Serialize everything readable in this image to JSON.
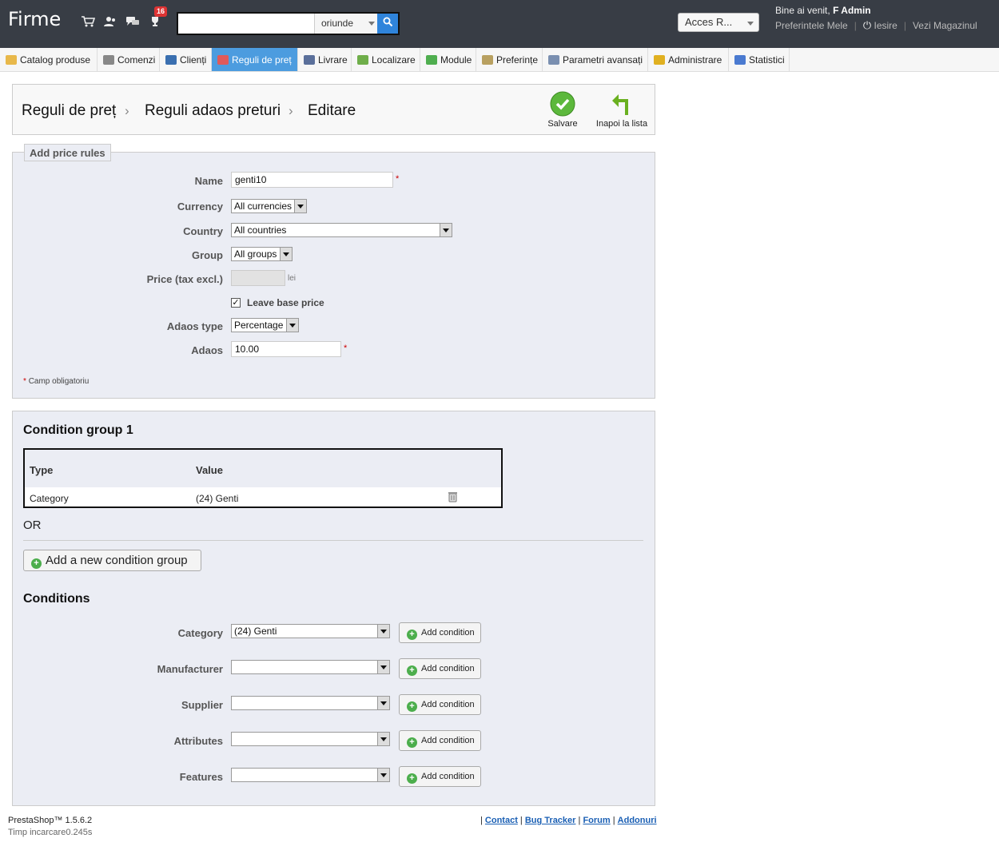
{
  "header": {
    "brand": "Firme",
    "badge_count": "16",
    "search_value": "",
    "search_scope": "oriunde",
    "access_select": "Acces R...",
    "welcome_prefix": "Bine ai venit,",
    "welcome_user": "F Admin",
    "link_prefs": "Preferintele Mele",
    "link_logout": "Iesire",
    "link_shop": "Vezi Magazinul"
  },
  "menu": [
    {
      "label": "Catalog produse",
      "icon": "folder-icon",
      "color": "#e8b84a"
    },
    {
      "label": "Comenzi",
      "icon": "cart-icon",
      "color": "#888888"
    },
    {
      "label": "Clienți",
      "icon": "user-icon",
      "color": "#3a6fb0"
    },
    {
      "label": "Reguli de preț",
      "icon": "price-rule-icon",
      "color": "#e05a5a"
    },
    {
      "label": "Livrare",
      "icon": "truck-icon",
      "color": "#5a6f9a"
    },
    {
      "label": "Localizare",
      "icon": "globe-icon",
      "color": "#6fae4a"
    },
    {
      "label": "Module",
      "icon": "puzzle-icon",
      "color": "#4fae4f"
    },
    {
      "label": "Preferințe",
      "icon": "preferences-icon",
      "color": "#b8a060"
    },
    {
      "label": "Parametri avansați",
      "icon": "wrench-icon",
      "color": "#7a8fb0"
    },
    {
      "label": "Administrare",
      "icon": "key-icon",
      "color": "#e0b020"
    },
    {
      "label": "Statistici",
      "icon": "stats-icon",
      "color": "#4a7ad0"
    }
  ],
  "breadcrumb": {
    "level1": "Reguli de preț",
    "level2": "Reguli adaos preturi",
    "level3": "Editare"
  },
  "toolbar": {
    "save_label": "Salvare",
    "back_label": "Inapoi la lista"
  },
  "form": {
    "legend": "Add price rules",
    "name_label": "Name",
    "name_value": "genti10",
    "currency_label": "Currency",
    "currency_value": "All currencies",
    "country_label": "Country",
    "country_value": "All countries",
    "group_label": "Group",
    "group_value": "All groups",
    "price_label": "Price (tax excl.)",
    "price_value": "",
    "price_unit": "lei",
    "leave_base_label": "Leave base price",
    "leave_base_checked": true,
    "adaos_type_label": "Adaos type",
    "adaos_type_value": "Percentage",
    "adaos_label": "Adaos",
    "adaos_value": "10.00",
    "required_note": "Camp obligatoriu",
    "required_mark": "*"
  },
  "conditions": {
    "group_title": "Condition group 1",
    "table_headers": [
      "Type",
      "Value"
    ],
    "rows": [
      {
        "type": "Category",
        "value": "(24) Genti"
      }
    ],
    "or_label": "OR",
    "add_group_label": "Add a new condition group",
    "conditions_title": "Conditions",
    "add_condition_label": "Add condition",
    "fields": [
      {
        "label": "Category",
        "value": "(24) Genti"
      },
      {
        "label": "Manufacturer",
        "value": ""
      },
      {
        "label": "Supplier",
        "value": ""
      },
      {
        "label": "Attributes",
        "value": ""
      },
      {
        "label": "Features",
        "value": ""
      }
    ]
  },
  "footer": {
    "version": "PrestaShop™ 1.5.6.2",
    "load_time": "Timp incarcare0.245s",
    "links": [
      "Contact",
      "Bug Tracker",
      "Forum",
      "Addonuri"
    ]
  }
}
